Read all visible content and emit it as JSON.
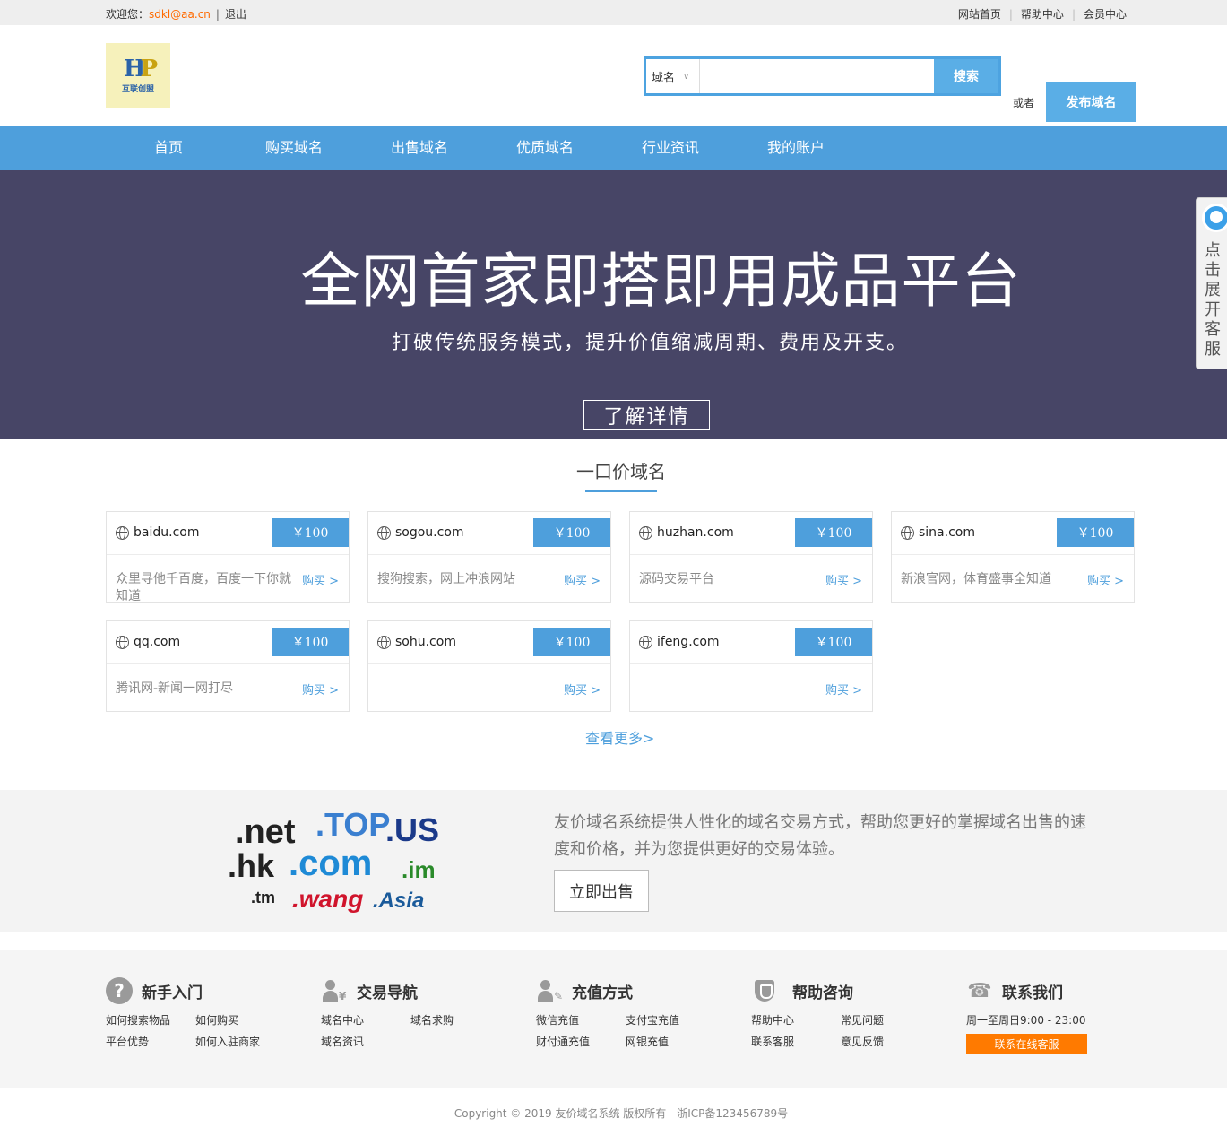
{
  "topbar": {
    "welcome": "欢迎您：",
    "username": "sdkl@aa.cn",
    "logout": "退出",
    "links": [
      "网站首页",
      "帮助中心",
      "会员中心"
    ]
  },
  "logo": {
    "mark": "HP",
    "text": "互联创盟"
  },
  "search": {
    "select_value": "域名",
    "placeholder": "",
    "button": "搜索",
    "or": "或者",
    "publish": "发布域名"
  },
  "nav": [
    "首页",
    "购买域名",
    "出售域名",
    "优质域名",
    "行业资讯",
    "我的账户"
  ],
  "banner": {
    "title": "全网首家即搭即用成品平台",
    "subtitle": "打破传统服务模式，提升价值缩减周期、费用及开支。",
    "button": "了解详情"
  },
  "side_service": {
    "label": "点击展开客服"
  },
  "fixed_price": {
    "title": "一口价域名",
    "cards": [
      {
        "domain": "baidu.com",
        "price": "￥100",
        "desc": "众里寻他千百度，百度一下你就知道",
        "buy": "购买 >"
      },
      {
        "domain": "sogou.com",
        "price": "￥100",
        "desc": "搜狗搜索，网上冲浪网站",
        "buy": "购买 >"
      },
      {
        "domain": "huzhan.com",
        "price": "￥100",
        "desc": "源码交易平台",
        "buy": "购买 >"
      },
      {
        "domain": "sina.com",
        "price": "￥100",
        "desc": "新浪官网，体育盛事全知道",
        "buy": "购买 >"
      },
      {
        "domain": "qq.com",
        "price": "￥100",
        "desc": "腾讯网-新闻一网打尽",
        "buy": "购买 >"
      },
      {
        "domain": "sohu.com",
        "price": "￥100",
        "desc": "",
        "buy": "购买 >"
      },
      {
        "domain": "ifeng.com",
        "price": "￥100",
        "desc": "",
        "buy": "购买 >"
      }
    ],
    "view_more": "查看更多>"
  },
  "promo": {
    "tlds": [
      ".net",
      ".TOP",
      ".US",
      ".hk",
      ".com",
      ".im",
      ".tm",
      ".wang",
      ".Asia"
    ],
    "text": "友价域名系统提供人性化的域名交易方式，帮助您更好的掌握域名出售的速度和价格，并为您提供更好的交易体验。",
    "button": "立即出售"
  },
  "footer": {
    "cols": [
      {
        "title": "新手入门",
        "icon": "question-icon",
        "links": [
          "如何搜索物品",
          "如何购买",
          "平台优势",
          "如何入驻商家"
        ]
      },
      {
        "title": "交易导航",
        "icon": "user-money-icon",
        "links": [
          "域名中心",
          "域名求购",
          "域名资讯"
        ]
      },
      {
        "title": "充值方式",
        "icon": "user-card-icon",
        "links": [
          "微信充值",
          "支付宝充值",
          "财付通充值",
          "网银充值"
        ]
      },
      {
        "title": "帮助咨询",
        "icon": "shield-icon",
        "links": [
          "帮助中心",
          "常见问题",
          "联系客服",
          "意见反馈"
        ]
      },
      {
        "title": "联系我们",
        "icon": "phone-icon",
        "hours": "周一至周日9:00 - 23:00",
        "button": "联系在线客服"
      }
    ],
    "copyright": "Copyright © 2019 友价域名系统 版权所有 - 浙ICP备123456789号"
  },
  "colors": {
    "primary": "#4e9fdc",
    "banner_bg": "#474566",
    "accent": "#ff7a00"
  }
}
